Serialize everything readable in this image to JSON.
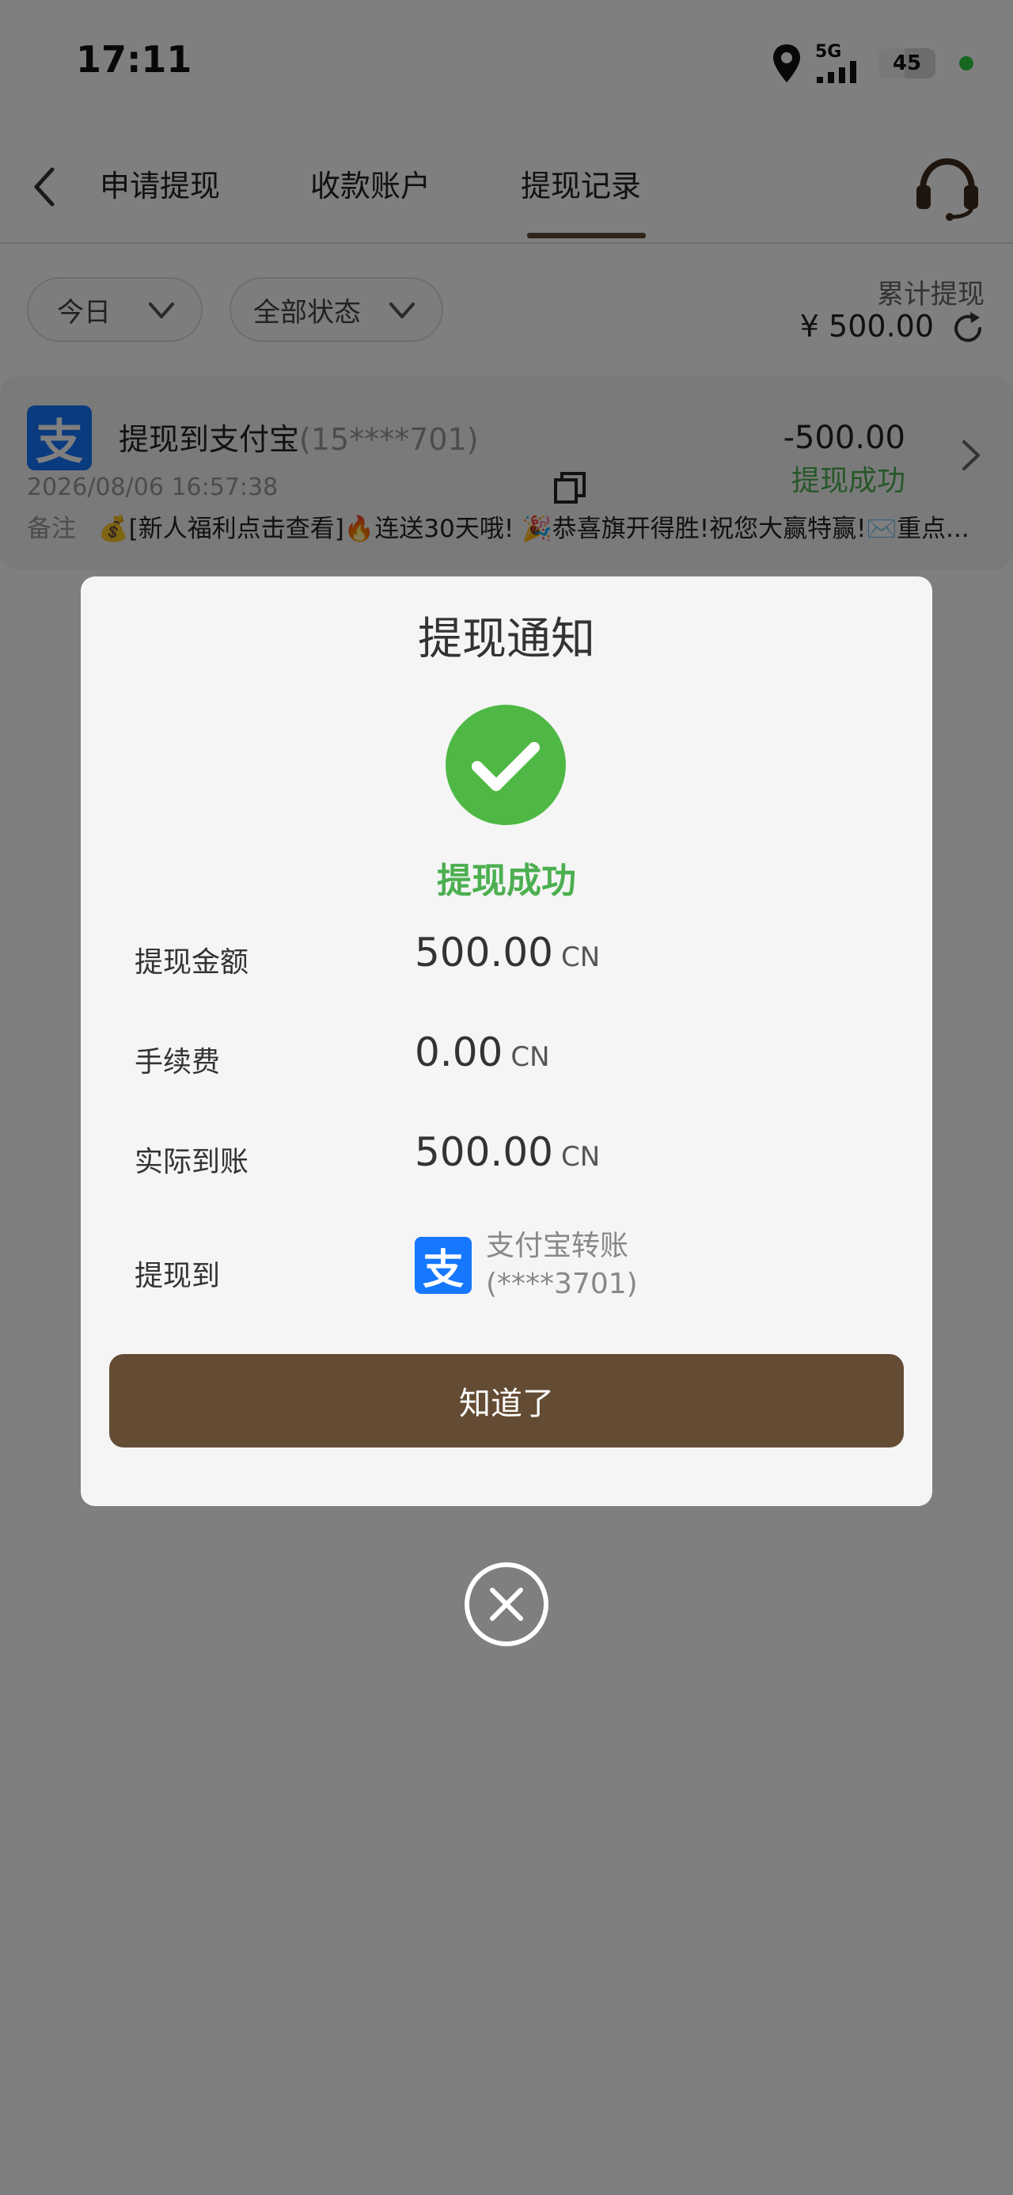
{
  "status_bar": {
    "time": "17:11",
    "network": "5G",
    "battery": "45"
  },
  "nav": {
    "tabs": [
      {
        "label": "申请提现"
      },
      {
        "label": "收款账户"
      },
      {
        "label": "提现记录",
        "active": true
      }
    ],
    "icons": {
      "back": "chevron-left-icon",
      "support": "headset-icon"
    }
  },
  "filters": {
    "date": "今日",
    "status": "全部状态",
    "total_label": "累计提现",
    "total_value": "¥ 500.00"
  },
  "record": {
    "title": "提现到支付宝",
    "account": "(15****701)",
    "amount": "-500.00",
    "status": "提现成功",
    "datetime": "2026/08/06 16:57:38",
    "note_label": "备注",
    "note": "💰[新人福利点击查看]🔥连送30天哦! 🎉恭喜旗开得胜!祝您大赢特赢!✉️重点...",
    "logo_char": "支"
  },
  "modal": {
    "title": "提现通知",
    "status": "提现成功",
    "rows": [
      {
        "label": "提现金额",
        "value": "500.00",
        "unit": "CN"
      },
      {
        "label": "手续费",
        "value": "0.00",
        "unit": "CN"
      },
      {
        "label": "实际到账",
        "value": "500.00",
        "unit": "CN"
      }
    ],
    "dest_label": "提现到",
    "dest_name": "支付宝转账",
    "dest_account": "(****3701)",
    "dest_logo_char": "支",
    "confirm_button": "知道了"
  },
  "colors": {
    "accent_brown": "#634b34",
    "success_green": "#4caf50",
    "alipay_blue": "#1677ff"
  }
}
